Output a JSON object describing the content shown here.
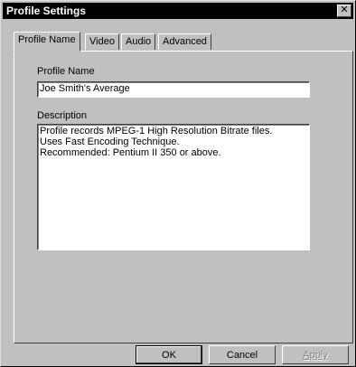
{
  "window": {
    "title": "Profile Settings",
    "close_glyph": "✕"
  },
  "tabs": [
    {
      "label": "Profile Name"
    },
    {
      "label": "Video"
    },
    {
      "label": "Audio"
    },
    {
      "label": "Advanced"
    }
  ],
  "profile_name": {
    "label": "Profile Name",
    "value": "Joe Smith's Average"
  },
  "description": {
    "label": "Description",
    "lines": [
      "Profile records MPEG-1 High Resolution Bitrate files.",
      "Uses Fast Encoding Technique.",
      "Recommended: Pentium II 350 or above."
    ]
  },
  "buttons": {
    "ok": "OK",
    "cancel": "Cancel",
    "apply": "Apply"
  }
}
